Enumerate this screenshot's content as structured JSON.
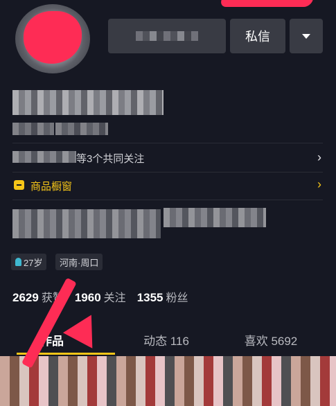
{
  "header": {
    "follow_button_label": "",
    "message_button_label": "私信",
    "more_icon": "triangle-down-icon"
  },
  "mutual": {
    "text": "等3个共同关注"
  },
  "shop": {
    "label": "商品橱窗",
    "icon": "shop-icon",
    "accent": "#f5c518"
  },
  "tags": [
    {
      "label": "27岁",
      "icon": "male-icon"
    },
    {
      "label": "河南·周口"
    }
  ],
  "stats": [
    {
      "value": "2629",
      "label": "获赞"
    },
    {
      "value": "1960",
      "label": "关注"
    },
    {
      "value": "1355",
      "label": "粉丝"
    }
  ],
  "tabs": [
    {
      "label": "作品",
      "active": true
    },
    {
      "label": "动态 116"
    },
    {
      "label": "喜欢 5692"
    }
  ],
  "colors": {
    "background": "#161823",
    "button": "#393b44",
    "annotation_red": "#fe2c55",
    "tab_indicator": "#f5c518"
  }
}
